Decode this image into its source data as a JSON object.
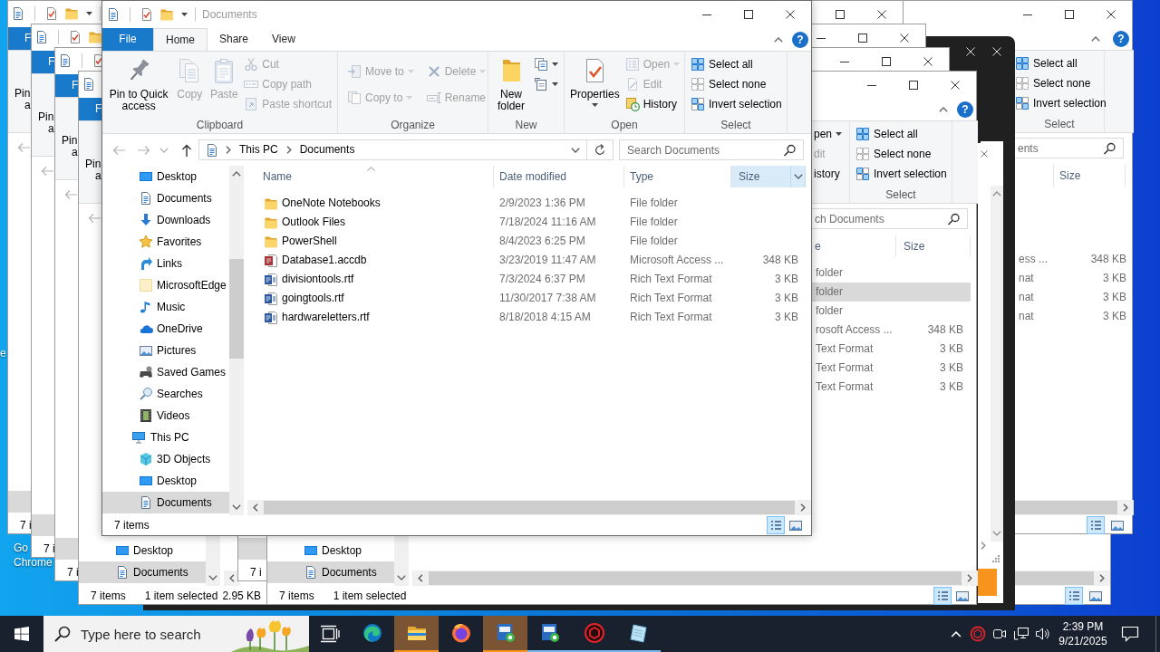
{
  "window": {
    "title": "Documents",
    "help": "?"
  },
  "ribbon": {
    "tabs": [
      {
        "label": "File",
        "kind": "file",
        "selected": false
      },
      {
        "label": "Home",
        "kind": "tab",
        "selected": true
      },
      {
        "label": "Share",
        "kind": "tab",
        "selected": false
      },
      {
        "label": "View",
        "kind": "tab",
        "selected": false
      }
    ],
    "groups": [
      {
        "label": "Clipboard",
        "items": [
          {
            "kind": "large",
            "label": "Pin to Quick access",
            "disabled": false,
            "dropdown": false
          },
          {
            "kind": "large",
            "label": "Copy",
            "disabled": true,
            "dropdown": false
          },
          {
            "kind": "large",
            "label": "Paste",
            "disabled": true,
            "dropdown": false
          },
          {
            "kind": "small",
            "label": "Cut",
            "disabled": true,
            "dropdown": false
          },
          {
            "kind": "small",
            "label": "Copy path",
            "disabled": true,
            "dropdown": false
          },
          {
            "kind": "small",
            "label": "Paste shortcut",
            "disabled": true,
            "dropdown": false
          }
        ]
      },
      {
        "label": "Organize",
        "items": [
          {
            "kind": "medium",
            "label": "Move to",
            "disabled": true,
            "dropdown": true
          },
          {
            "kind": "medium",
            "label": "Copy to",
            "disabled": true,
            "dropdown": true
          },
          {
            "kind": "medium",
            "label": "Delete",
            "disabled": true,
            "dropdown": true
          },
          {
            "kind": "medium",
            "label": "Rename",
            "disabled": true,
            "dropdown": false
          }
        ]
      },
      {
        "label": "New",
        "items": [
          {
            "kind": "large",
            "label": "New folder",
            "disabled": false,
            "dropdown": false
          },
          {
            "kind": "icon",
            "disabled": false,
            "dropdown": true
          },
          {
            "kind": "icon",
            "disabled": false,
            "dropdown": true
          }
        ]
      },
      {
        "label": "Open",
        "items": [
          {
            "kind": "large",
            "label": "Properties",
            "disabled": false,
            "dropdown": true
          },
          {
            "kind": "small",
            "label": "Open",
            "disabled": true,
            "dropdown": true
          },
          {
            "kind": "small",
            "label": "Edit",
            "disabled": true,
            "dropdown": false
          },
          {
            "kind": "small",
            "label": "History",
            "disabled": false,
            "dropdown": false
          }
        ]
      },
      {
        "label": "Select",
        "items": [
          {
            "kind": "small",
            "label": "Select all",
            "disabled": false,
            "dropdown": false
          },
          {
            "kind": "small",
            "label": "Select none",
            "disabled": false,
            "dropdown": false
          },
          {
            "kind": "small",
            "label": "Invert selection",
            "disabled": false,
            "dropdown": false
          }
        ]
      }
    ]
  },
  "navigation": {
    "buttons": [
      {
        "kind": "back",
        "disabled": true
      },
      {
        "kind": "forward",
        "disabled": true
      },
      {
        "kind": "recent",
        "disabled": true
      },
      {
        "kind": "up",
        "disabled": false
      }
    ],
    "path": [
      "This PC",
      "Documents"
    ],
    "search": {
      "placeholder": "Search Documents"
    }
  },
  "nav_tree": [
    {
      "children": [
        {
          "label": "Desktop",
          "kind": "desktop",
          "selected": false
        },
        {
          "label": "Documents",
          "kind": "documents",
          "selected": false
        },
        {
          "label": "Downloads",
          "kind": "downloads",
          "selected": false
        },
        {
          "label": "Favorites",
          "kind": "favorites",
          "selected": false
        },
        {
          "label": "Links",
          "kind": "links",
          "selected": false
        },
        {
          "label": "MicrosoftEdge",
          "kind": "folder",
          "selected": false
        },
        {
          "label": "Music",
          "kind": "music",
          "selected": false
        },
        {
          "label": "OneDrive",
          "kind": "onedrive",
          "selected": false
        },
        {
          "label": "Pictures",
          "kind": "pictures",
          "selected": false
        },
        {
          "label": "Saved Games",
          "kind": "games",
          "selected": false
        },
        {
          "label": "Searches",
          "kind": "searches",
          "selected": false
        },
        {
          "label": "Videos",
          "kind": "videos",
          "selected": false
        }
      ]
    },
    {
      "label": "This PC",
      "kind": "pc",
      "selected": false,
      "children": [
        {
          "label": "3D Objects",
          "kind": "objects3d",
          "selected": false
        },
        {
          "label": "Desktop",
          "kind": "desktop",
          "selected": false
        },
        {
          "label": "Documents",
          "kind": "documents",
          "selected": true
        }
      ]
    }
  ],
  "file_list": {
    "columns": [
      {
        "label": "Name",
        "sorted": true,
        "highlighted": false
      },
      {
        "label": "Date modified",
        "sorted": false,
        "highlighted": false
      },
      {
        "label": "Type",
        "sorted": false,
        "highlighted": false
      },
      {
        "label": "Size",
        "sorted": false,
        "highlighted": true
      }
    ],
    "rows": [
      {
        "kind": "folder",
        "name": "OneNote Notebooks",
        "date": "2/9/2023 1:36 PM",
        "type": "File folder",
        "selected": false
      },
      {
        "kind": "folder",
        "name": "Outlook Files",
        "date": "7/18/2024 11:16 AM",
        "type": "File folder",
        "selected": false
      },
      {
        "kind": "folder",
        "name": "PowerShell",
        "date": "8/4/2023 6:25 PM",
        "type": "File folder",
        "selected": false
      },
      {
        "kind": "access",
        "name": "Database1.accdb",
        "date": "3/23/2019 11:47 AM",
        "type": "Microsoft Access ...",
        "size": "348 KB",
        "selected": false
      },
      {
        "kind": "rtf",
        "name": "divisiontools.rtf",
        "date": "7/3/2024 6:37 PM",
        "type": "Rich Text Format",
        "size": "3 KB",
        "selected": false
      },
      {
        "kind": "rtf",
        "name": "goingtools.rtf",
        "date": "11/30/2017 7:38 AM",
        "type": "Rich Text Format",
        "size": "3 KB",
        "selected": false
      },
      {
        "kind": "rtf",
        "name": "hardwareletters.rtf",
        "date": "8/18/2018 4:15 AM",
        "type": "Rich Text Format",
        "size": "3 KB",
        "selected": false
      }
    ]
  },
  "status_bar": {
    "text": "7 items",
    "view_buttons": [
      {
        "kind": "details",
        "selected": true
      },
      {
        "kind": "large_icons",
        "selected": false
      }
    ]
  },
  "back_windows": [
    {
      "kind": "cascade",
      "file_tab": "F",
      "ribbon_fragment": [
        "Pin",
        "a"
      ],
      "status_fragment": "7 i"
    },
    {
      "kind": "cascade",
      "file_tab": "F",
      "ribbon_fragment": [
        "Pin",
        "a"
      ],
      "status_fragment": "7 i"
    },
    {
      "kind": "cascade",
      "file_tab": "F",
      "ribbon_fragment": [
        "Pin",
        "a"
      ],
      "status_fragment": "7 i"
    },
    {
      "kind": "cascade",
      "file_tab": "F",
      "ribbon_fragment": [
        "Pin",
        "a"
      ],
      "nav_items": [
        {
          "label": "Desktop",
          "kind": "desktop",
          "selected": false
        },
        {
          "label": "Documents",
          "kind": "documents",
          "selected": true
        }
      ],
      "status": [
        "7 items",
        "1 item selected",
        "2.95 KB"
      ]
    },
    {
      "kind": "strip",
      "status_fragment": "7 i"
    },
    {
      "kind": "clone",
      "help": "?",
      "open_group": [
        {
          "label": "pen",
          "disabled": false,
          "dropdown": true
        },
        {
          "label": "dit",
          "disabled": true,
          "dropdown": false
        },
        {
          "label": "istory",
          "disabled": false,
          "dropdown": false
        }
      ],
      "select_group": {
        "actions": [
          "Select all",
          "Select none",
          "Invert selection"
        ],
        "label": "Select"
      },
      "search": {
        "placeholder": "ch Documents"
      },
      "columns": [
        "e",
        "Size"
      ],
      "rows": [
        {
          "type": "folder",
          "selected": false
        },
        {
          "type": "folder",
          "selected": true
        },
        {
          "type": "folder",
          "selected": false
        },
        {
          "type": "rosoft Access ...",
          "size": "348 KB",
          "selected": false
        },
        {
          "type": "Text Format",
          "size": "3 KB",
          "selected": false
        },
        {
          "type": "Text Format",
          "size": "3 KB",
          "selected": false
        },
        {
          "type": "Text Format",
          "size": "3 KB",
          "selected": false
        }
      ],
      "nav_items": [
        {
          "label": "Desktop",
          "kind": "desktop",
          "selected": false
        },
        {
          "label": "Documents",
          "kind": "documents",
          "selected": true
        }
      ],
      "status": [
        "7 items",
        "1 item selected"
      ],
      "view_buttons": [
        {
          "kind": "details",
          "selected": true
        },
        {
          "kind": "large_icons",
          "selected": false
        }
      ]
    },
    {
      "kind": "dark"
    },
    {
      "kind": "dark"
    },
    {
      "kind": "wide",
      "help": "?",
      "select_group": {
        "actions": [
          "Select all",
          "Select none",
          "Invert selection"
        ],
        "label": "Select"
      },
      "search": {
        "placeholder": "ents"
      },
      "columns": [
        "Size"
      ],
      "rows": [
        {
          "type": "ess ...",
          "size": "348 KB"
        },
        {
          "type": "nat",
          "size": "3 KB"
        },
        {
          "type": "nat",
          "size": "3 KB"
        },
        {
          "type": "nat",
          "size": "3 KB"
        }
      ],
      "view_buttons": [
        {
          "kind": "details",
          "selected": true
        },
        {
          "kind": "large_icons",
          "selected": false
        }
      ]
    },
    {
      "kind": "corner",
      "view_buttons": [
        {
          "kind": "details",
          "selected": true
        },
        {
          "kind": "large_icons",
          "selected": false
        }
      ]
    }
  ],
  "desktop": {
    "labels": [
      {
        "lines": [
          "e"
        ]
      },
      {
        "lines": [
          "Go",
          "Chrome"
        ]
      }
    ]
  },
  "taskbar": {
    "search": {
      "placeholder": "Type here to search"
    },
    "apps": [
      {
        "kind": "edge",
        "active": false,
        "running": false
      },
      {
        "kind": "explorer",
        "active": true,
        "running": false
      },
      {
        "kind": "firefox",
        "active": false,
        "running": false
      },
      {
        "kind": "installer",
        "active": true,
        "running": false
      },
      {
        "kind": "installer",
        "active": false,
        "running": true
      },
      {
        "kind": "ring",
        "active": false,
        "running": true
      },
      {
        "kind": "notepad",
        "active": false,
        "running": true
      }
    ],
    "clock": {
      "time": "2:39 PM",
      "date": "9/21/2025"
    }
  }
}
